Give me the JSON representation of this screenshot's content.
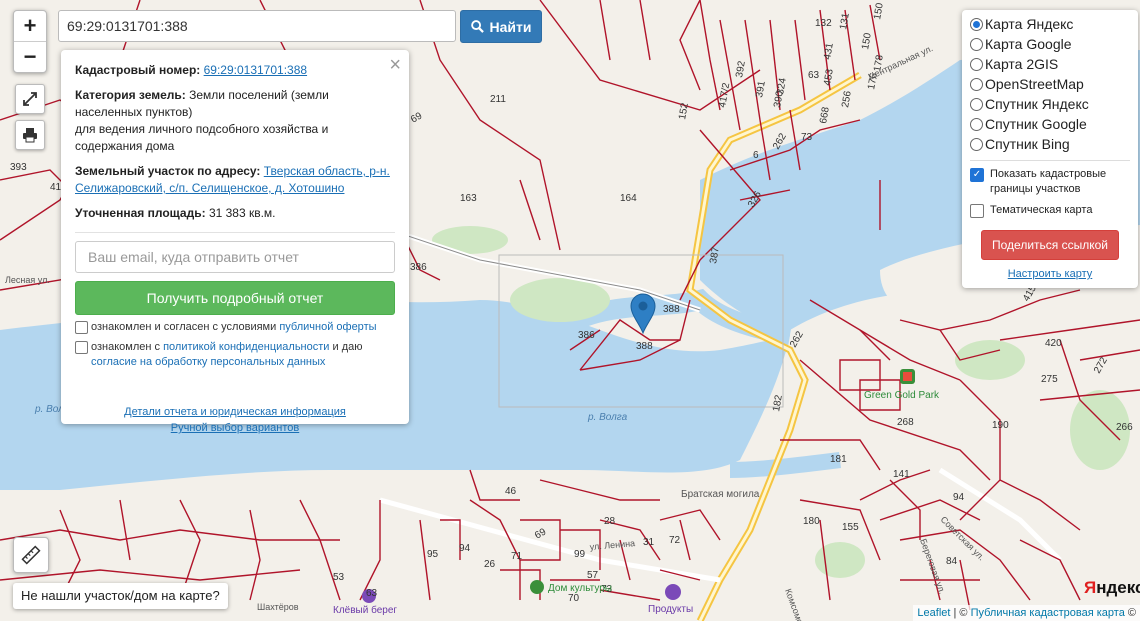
{
  "search": {
    "value": "69:29:0131701:388",
    "button_label": "Найти"
  },
  "zoom": {
    "in_label": "+",
    "out_label": "−"
  },
  "info_panel": {
    "close_label": "×",
    "cadastral_label": "Кадастровый номер:",
    "cadastral_value": "69:29:0131701:388",
    "category_label": "Категория земель:",
    "category_value": "Земли поселений (земли населенных пунктов)",
    "category_use": "для ведения личного подсобного хозяйства и содержания дома",
    "address_label": "Земельный участок по адресу:",
    "address_value": "Тверская область, р-н. Селижаровский, с/п. Селищенское, д. Хотошино",
    "area_label": "Уточненная площадь:",
    "area_value": "31 383 кв.м.",
    "email_placeholder": "Ваш email, куда отправить отчет",
    "report_button": "Получить подробный отчет",
    "agree1_prefix": "ознакомлен и согласен с условиями",
    "agree1_link": "публичной оферты",
    "agree2_prefix": "ознакомлен с",
    "agree2_link1": "политикой конфиденциальности",
    "agree2_mid": "и даю",
    "agree2_link2": "согласие на обработку персональных данных",
    "details_link": "Детали отчета и юридическая информация",
    "manual_link": "Ручной выбор вариантов"
  },
  "layers": {
    "options": [
      {
        "label": "Карта Яндекс",
        "selected": true
      },
      {
        "label": "Карта Google",
        "selected": false
      },
      {
        "label": "Карта 2GIS",
        "selected": false
      },
      {
        "label": "OpenStreetMap",
        "selected": false
      },
      {
        "label": "Спутник Яндекс",
        "selected": false
      },
      {
        "label": "Спутник Google",
        "selected": false
      },
      {
        "label": "Спутник Bing",
        "selected": false
      }
    ],
    "show_borders": "Показать кадастровые границы участков",
    "thematic": "Тематическая карта",
    "share_button": "Поделиться ссылкой",
    "config_link": "Настроить карту"
  },
  "map_labels": {
    "parcels": [
      "211",
      "163",
      "164",
      "69",
      "132",
      "131",
      "150",
      "176",
      "150",
      "178",
      "392",
      "391",
      "390",
      "417/2",
      "324",
      "431",
      "453",
      "256",
      "668",
      "63",
      "152",
      "73",
      "262",
      "6",
      "326",
      "387",
      "386",
      "386",
      "388",
      "388",
      "262",
      "182",
      "415",
      "420",
      "275",
      "272",
      "190",
      "266",
      "268",
      "181",
      "141",
      "180",
      "155",
      "94",
      "84",
      "28",
      "46",
      "95",
      "94",
      "26",
      "71",
      "69",
      "99",
      "73",
      "63",
      "70",
      "31",
      "72",
      "57",
      "53",
      "393",
      "41"
    ],
    "places": [
      "Green Gold Park",
      "Братская могила",
      "Дом культуры",
      "Продукты",
      "Клёвый берег"
    ],
    "rivers": [
      "р. Волга",
      "р. Волга"
    ],
    "streets": [
      "Центральная ул.",
      "Советская ул.",
      "Лесная ул.",
      "ул. Ленина",
      "Шахтёров",
      "Комсомольская",
      "Береговая ул."
    ]
  },
  "not_found": "Не нашли участок/дом на карте?",
  "attribution": {
    "leaflet": "Leaflet",
    "sep": " | © ",
    "pkk": "Публичная кадастровая карта",
    "end": " ©"
  },
  "yandex_logo": {
    "ya": "Я",
    "ndex": "ндекс"
  }
}
